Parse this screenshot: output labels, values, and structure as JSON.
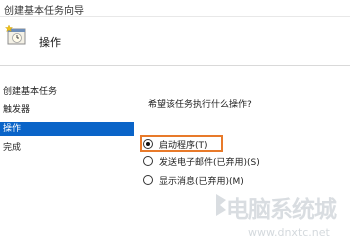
{
  "window": {
    "title": "创建基本任务向导"
  },
  "header": {
    "heading": "操作",
    "icon": "scheduled-task-wizard-icon"
  },
  "sidebar": {
    "items": [
      {
        "label": "创建基本任务",
        "active": false
      },
      {
        "label": "触发器",
        "active": false
      },
      {
        "label": "操作",
        "active": true
      },
      {
        "label": "完成",
        "active": false
      }
    ]
  },
  "content": {
    "question": "希望该任务执行什么操作?",
    "options": [
      {
        "label": "启动程序(T)",
        "checked": true
      },
      {
        "label": "发送电子邮件(已弃用)(S)",
        "checked": false
      },
      {
        "label": "显示消息(已弃用)(M)",
        "checked": false
      }
    ],
    "highlight_color": "#e87a2a"
  },
  "watermark": {
    "text": "电脑系统城",
    "url": "www.dnxtc.net"
  },
  "colors": {
    "accent": "#0a64c8"
  }
}
